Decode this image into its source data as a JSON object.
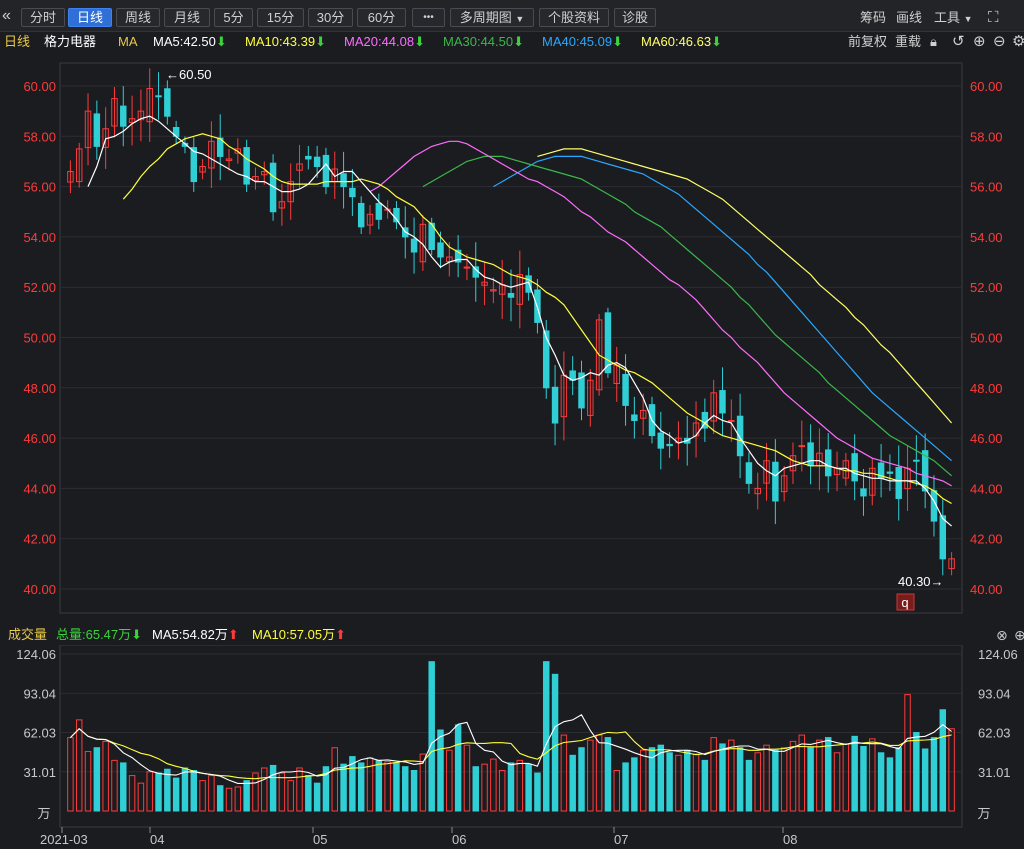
{
  "toolbar": {
    "collapse_icon": "double-chevron-left-icon",
    "tabs": [
      {
        "label": "分时",
        "active": false
      },
      {
        "label": "日线",
        "active": true
      },
      {
        "label": "周线",
        "active": false
      },
      {
        "label": "月线",
        "active": false
      },
      {
        "label": "5分",
        "active": false
      },
      {
        "label": "15分",
        "active": false
      },
      {
        "label": "30分",
        "active": false
      },
      {
        "label": "60分",
        "active": false
      }
    ],
    "more_label": "•••",
    "multi_period": "多周期图",
    "stock_info": "个股资料",
    "diagnose": "诊股",
    "chips": "筹码",
    "draw": "画线",
    "tools": "工具"
  },
  "ma_bar": {
    "period": "日线",
    "stock": "格力电器",
    "ma_label": "MA",
    "ma5": "MA5:42.50",
    "ma10": "MA10:43.39",
    "ma20": "MA20:44.08",
    "ma30": "MA30:44.50",
    "ma40": "MA40:45.09",
    "ma60": "MA60:46.63",
    "fq": "前复权",
    "reset": "重载"
  },
  "vol_bar": {
    "label": "成交量",
    "total": "总量:65.47万",
    "ma5": "MA5:54.82万",
    "ma10": "MA10:57.05万"
  },
  "colors": {
    "up": "#ff3a3a",
    "down": "#30cfd6",
    "ma5": "#ffffff",
    "ma10": "#ffff3a",
    "ma20": "#ff6cff",
    "ma30": "#3ab84a",
    "ma40": "#2aa8ff",
    "ma60": "#ffff6a"
  },
  "chart_data": {
    "type": "candlestick",
    "price_axis": {
      "min": 40.0,
      "max": 60.0,
      "ticks": [
        "60.00",
        "58.00",
        "56.00",
        "54.00",
        "52.00",
        "50.00",
        "48.00",
        "46.00",
        "44.00",
        "42.00",
        "40.00"
      ]
    },
    "volume_axis": {
      "ticks": [
        "124.06",
        "93.04",
        "62.03",
        "31.01",
        "万"
      ]
    },
    "x_labels": [
      "2021-03",
      "04",
      "05",
      "06",
      "07",
      "08"
    ],
    "high_annotation": "←60.50",
    "low_annotation": "40.30→",
    "marker": "q",
    "close": [
      56.6,
      57.5,
      59.0,
      57.6,
      58.3,
      59.5,
      58.4,
      58.7,
      59.0,
      59.9,
      59.6,
      58.8,
      58.0,
      57.6,
      56.2,
      56.8,
      57.8,
      57.2,
      57.1,
      57.5,
      56.1,
      56.4,
      56.6,
      55.0,
      55.4,
      56.2,
      56.9,
      57.1,
      56.8,
      56.0,
      56.7,
      56.0,
      55.6,
      54.4,
      54.9,
      54.7,
      55.1,
      54.6,
      54.0,
      53.4,
      54.5,
      53.5,
      53.2,
      53.2,
      53.0,
      52.8,
      52.4,
      52.2,
      51.9,
      52.1,
      51.6,
      52.5,
      51.8,
      50.6,
      48.0,
      46.6,
      48.5,
      48.3,
      47.2,
      48.3,
      50.7,
      48.6,
      48.9,
      47.3,
      46.7,
      47.1,
      46.1,
      45.6,
      45.7,
      46.0,
      45.8,
      46.6,
      46.4,
      47.8,
      47.0,
      46.7,
      45.3,
      44.2,
      44.0,
      45.1,
      43.5,
      44.5,
      45.3,
      45.7,
      44.9,
      45.4,
      44.5,
      44.8,
      45.1,
      44.3,
      43.7,
      44.8,
      44.4,
      44.6,
      43.6,
      44.8,
      45.1,
      43.9,
      42.7,
      41.2,
      41.2
    ],
    "volume": [
      58,
      72,
      47,
      50,
      55,
      40,
      38,
      28,
      22,
      31,
      30,
      33,
      26,
      34,
      32,
      24,
      28,
      20,
      18,
      19,
      24,
      30,
      34,
      36,
      30,
      24,
      34,
      28,
      22,
      35,
      50,
      37,
      43,
      38,
      42,
      40,
      39,
      38,
      35,
      32,
      45,
      118,
      64,
      48,
      68,
      52,
      35,
      37,
      41,
      32,
      38,
      40,
      37,
      30,
      118,
      108,
      60,
      44,
      50,
      56,
      60,
      58,
      32,
      38,
      42,
      48,
      50,
      52,
      46,
      44,
      48,
      45,
      40,
      58,
      53,
      56,
      50,
      40,
      46,
      52,
      48,
      50,
      55,
      60,
      50,
      56,
      58,
      46,
      53,
      59,
      51,
      57,
      46,
      42,
      50,
      92,
      62,
      49,
      58,
      80,
      65
    ],
    "ma5": [
      56.0,
      56.8,
      57.9,
      58.0,
      58.2,
      58.5,
      58.7,
      58.8,
      58.6,
      58.3,
      58.0,
      57.7,
      57.4,
      57.3,
      57.1,
      56.9,
      56.7,
      56.5,
      56.4,
      56.2,
      56.2,
      56.0,
      55.8,
      55.8,
      55.9,
      56.1,
      56.5,
      56.9,
      56.4,
      56.6,
      56.6,
      56.2,
      55.8,
      55.4,
      55.1,
      54.7,
      54.2,
      54.0,
      53.7,
      53.2,
      52.8,
      53.0,
      53.1,
      53.1,
      52.7,
      52.4,
      52.3,
      52.1,
      52.0,
      52.1,
      52.2,
      51.2,
      50.0,
      49.3,
      48.5,
      48.3,
      48.4,
      48.6,
      48.5,
      48.9,
      49.0,
      48.8,
      48.2,
      47.6,
      46.7,
      46.3,
      46.1,
      45.8,
      45.9,
      46.1,
      46.6,
      46.9,
      46.7,
      46.6,
      46.0,
      45.5,
      45.0,
      44.7,
      44.5,
      44.8,
      44.9,
      45.0,
      45.1,
      45.1,
      44.9,
      44.8,
      44.8,
      44.6,
      44.5,
      44.4,
      44.4,
      44.3,
      44.3,
      44.3,
      44.3,
      44.0,
      43.5,
      42.8,
      42.5
    ],
    "ma10": [
      55.5,
      55.9,
      56.4,
      56.8,
      57.1,
      57.5,
      57.7,
      57.9,
      58.0,
      58.1,
      58.0,
      57.9,
      57.6,
      57.4,
      57.1,
      56.9,
      56.7,
      56.4,
      56.2,
      56.1,
      56.1,
      56.1,
      56.1,
      56.2,
      56.2,
      56.2,
      56.2,
      56.3,
      56.2,
      56.1,
      55.9,
      55.6,
      55.4,
      55.2,
      54.8,
      54.5,
      54.0,
      53.6,
      53.4,
      53.2,
      53.1,
      53.0,
      52.9,
      52.7,
      52.5,
      52.4,
      52.3,
      52.1,
      51.8,
      51.6,
      51.3,
      50.8,
      50.3,
      49.8,
      49.3,
      49.1,
      48.9,
      48.7,
      48.6,
      48.4,
      48.2,
      47.9,
      47.6,
      47.3,
      47.0,
      46.8,
      46.6,
      46.3,
      46.1,
      46.0,
      45.9,
      45.8,
      45.7,
      45.6,
      45.5,
      45.3,
      45.1,
      45.0,
      44.9,
      44.9,
      44.9,
      44.8,
      44.7,
      44.7,
      44.6,
      44.6,
      44.5,
      44.4,
      44.3,
      44.3,
      44.2,
      44.1,
      43.9,
      43.6,
      43.4
    ],
    "ma20": [
      55.8,
      56.0,
      56.3,
      56.6,
      56.9,
      57.2,
      57.4,
      57.6,
      57.7,
      57.8,
      57.8,
      57.7,
      57.5,
      57.3,
      57.1,
      56.9,
      56.7,
      56.5,
      56.3,
      56.2,
      56.0,
      55.8,
      55.6,
      55.3,
      55.0,
      54.8,
      54.5,
      54.2,
      54.0,
      53.8,
      53.5,
      53.2,
      52.9,
      52.6,
      52.3,
      52.1,
      51.8,
      51.5,
      51.1,
      50.7,
      50.3,
      50.0,
      49.6,
      49.3,
      49.0,
      48.6,
      48.2,
      47.8,
      47.5,
      47.2,
      46.9,
      46.6,
      46.3,
      46.0,
      45.8,
      45.6,
      45.4,
      45.2,
      45.1,
      45.0,
      44.9,
      44.8,
      44.6,
      44.5,
      44.4,
      44.3,
      44.1
    ],
    "ma30": [
      56.0,
      56.2,
      56.4,
      56.6,
      56.8,
      57.0,
      57.1,
      57.2,
      57.2,
      57.2,
      57.1,
      57.0,
      56.9,
      56.8,
      56.7,
      56.6,
      56.5,
      56.4,
      56.3,
      56.1,
      55.9,
      55.7,
      55.5,
      55.3,
      55.0,
      54.8,
      54.6,
      54.4,
      54.1,
      53.8,
      53.5,
      53.2,
      52.9,
      52.6,
      52.3,
      52.0,
      51.6,
      51.3,
      50.9,
      50.5,
      50.1,
      49.8,
      49.5,
      49.2,
      48.9,
      48.6,
      48.2,
      47.9,
      47.6,
      47.3,
      47.0,
      46.7,
      46.4,
      46.1,
      45.9,
      45.7,
      45.5,
      45.3,
      45.1,
      44.8,
      44.5
    ],
    "ma40": [
      56.0,
      56.2,
      56.4,
      56.6,
      56.8,
      57.0,
      57.1,
      57.2,
      57.2,
      57.2,
      57.2,
      57.1,
      57.0,
      56.9,
      56.8,
      56.7,
      56.6,
      56.5,
      56.3,
      56.1,
      55.9,
      55.7,
      55.4,
      55.1,
      54.8,
      54.5,
      54.2,
      53.9,
      53.6,
      53.3,
      52.9,
      52.6,
      52.2,
      51.8,
      51.4,
      51.0,
      50.6,
      50.2,
      49.8,
      49.4,
      49.0,
      48.6,
      48.2,
      47.8,
      47.5,
      47.2,
      46.9,
      46.6,
      46.3,
      46.0,
      45.7,
      45.4,
      45.1
    ],
    "ma60": [
      57.2,
      57.3,
      57.4,
      57.5,
      57.5,
      57.5,
      57.4,
      57.3,
      57.2,
      57.1,
      57.0,
      56.9,
      56.8,
      56.7,
      56.6,
      56.5,
      56.4,
      56.3,
      56.1,
      55.9,
      55.7,
      55.5,
      55.2,
      54.9,
      54.6,
      54.3,
      54.0,
      53.7,
      53.4,
      53.1,
      52.8,
      52.5,
      52.1,
      51.8,
      51.5,
      51.2,
      50.8,
      50.5,
      50.1,
      49.7,
      49.4,
      49.0,
      48.6,
      48.2,
      47.8,
      47.4,
      47.0,
      46.6
    ]
  }
}
